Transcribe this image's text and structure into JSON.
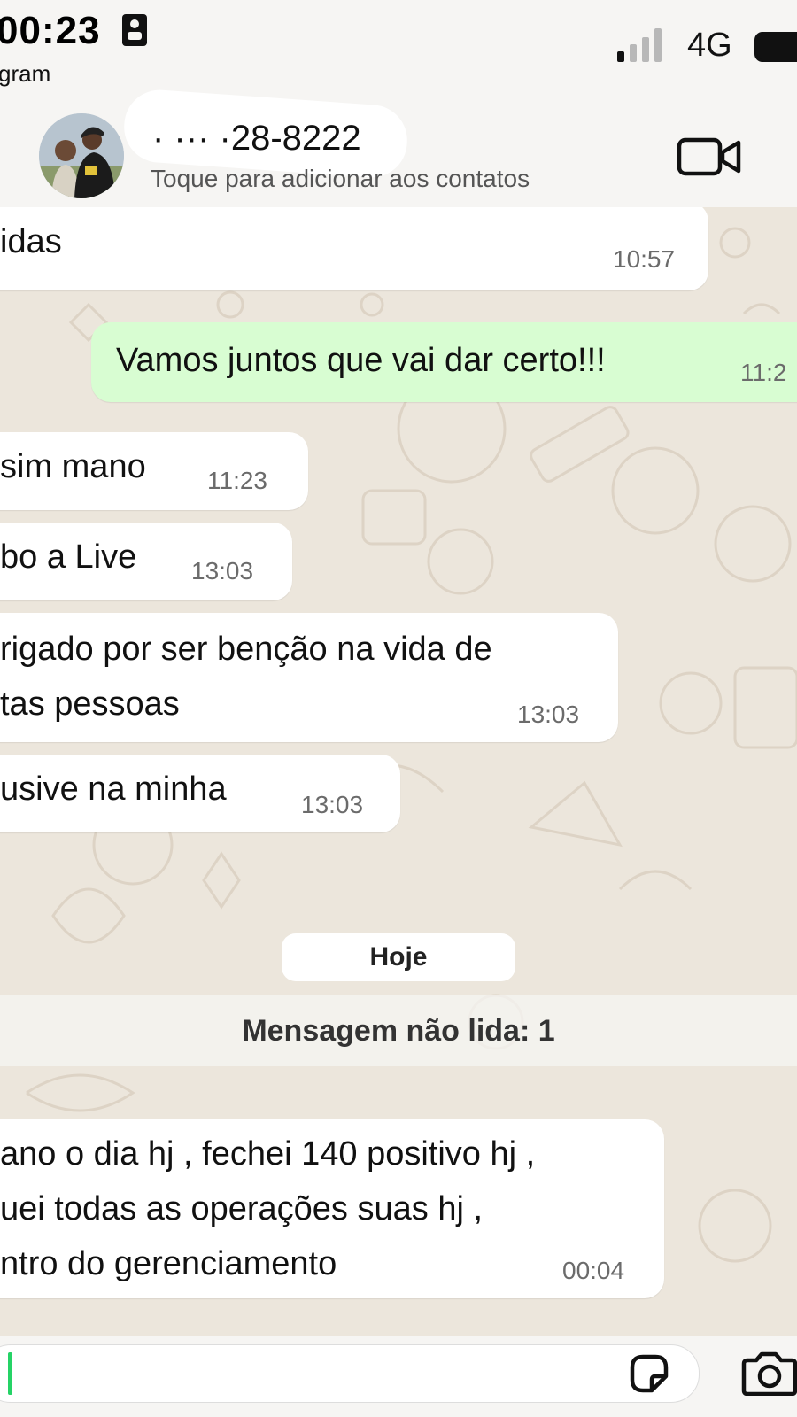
{
  "status_bar": {
    "time": "00:23",
    "back_app": "gram",
    "network": "4G"
  },
  "header": {
    "contact_name": "·   ··· ·28-8222",
    "subtitle": "Toque para adicionar aos contatos"
  },
  "messages": [
    {
      "direction": "in",
      "text": "idas",
      "time": "10:57"
    },
    {
      "direction": "out",
      "text": "Vamos juntos que vai dar certo!!!",
      "time": "11:2"
    },
    {
      "direction": "in",
      "text": "sim mano",
      "time": "11:23"
    },
    {
      "direction": "in",
      "text": "bo a Live",
      "time": "13:03"
    },
    {
      "direction": "in",
      "text": "rigado por ser benção na vida de\ntas pessoas",
      "time": "13:03"
    },
    {
      "direction": "in",
      "text": "usive na minha",
      "time": "13:03"
    },
    {
      "direction": "in",
      "text": "ano o dia hj , fechei 140 positivo hj ,\nuei todas as operações suas hj ,\nntro do gerenciamento",
      "time": "00:04"
    }
  ],
  "date_separator": "Hoje",
  "unread_banner": "Mensagem não lida: 1",
  "colors": {
    "chat_background": "#ece6dc",
    "outgoing_bubble": "#d8fdd2",
    "incoming_bubble": "#ffffff",
    "cursor_accent": "#25d366"
  },
  "icons": [
    "video-call-icon",
    "sticker-icon",
    "camera-icon",
    "id-badge-icon",
    "signal-icon",
    "battery-icon"
  ]
}
